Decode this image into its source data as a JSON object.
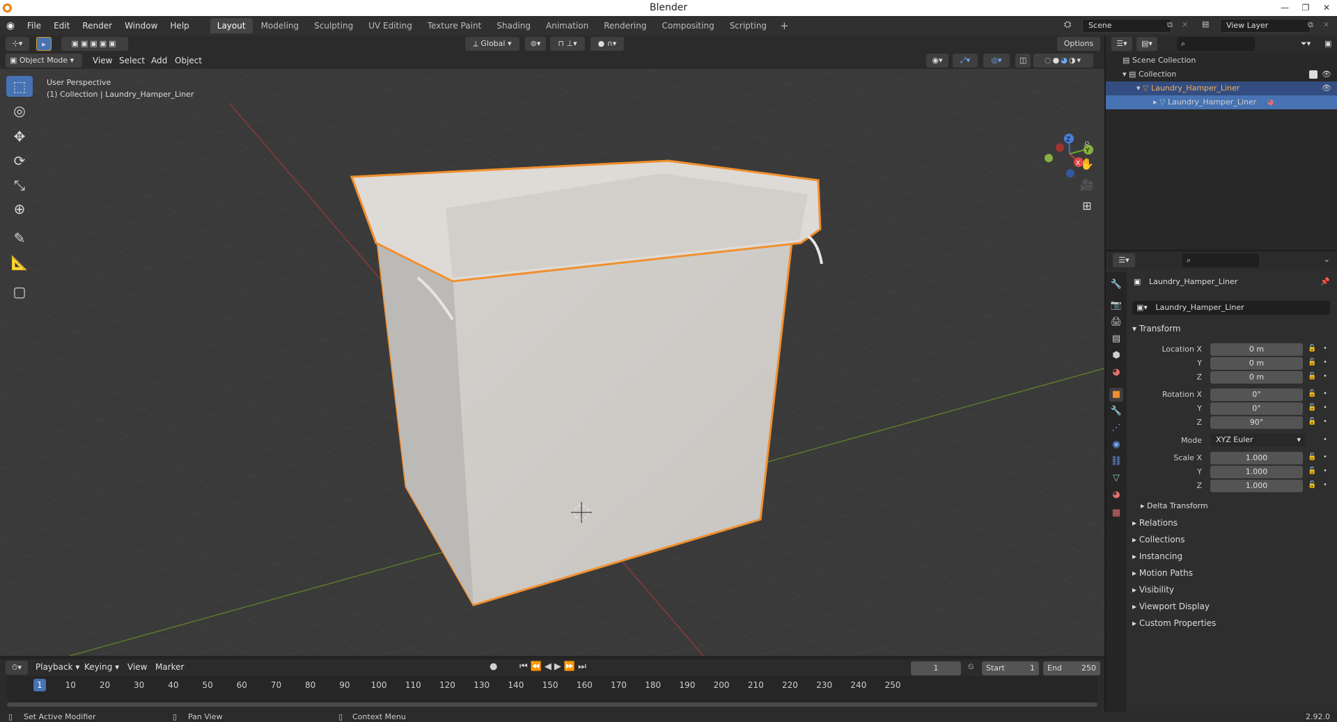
{
  "window": {
    "title": "Blender"
  },
  "menu": [
    "File",
    "Edit",
    "Render",
    "Window",
    "Help"
  ],
  "workspaces": [
    "Layout",
    "Modeling",
    "Sculpting",
    "UV Editing",
    "Texture Paint",
    "Shading",
    "Animation",
    "Rendering",
    "Compositing",
    "Scripting"
  ],
  "scene": {
    "scene_name": "Scene",
    "view_layer": "View Layer"
  },
  "viewport_header": {
    "orientation": "Global",
    "options": "Options",
    "mode": "Object Mode",
    "menus": [
      "View",
      "Select",
      "Add",
      "Object"
    ]
  },
  "viewport": {
    "perspective_label": "User Perspective",
    "collection_label": "(1) Collection | Laundry_Hamper_Liner",
    "axes": {
      "x": "X",
      "y": "Y",
      "z": "Z"
    }
  },
  "outliner": {
    "scene_collection": "Scene Collection",
    "collection": "Collection",
    "object": "Laundry_Hamper_Liner",
    "mesh": "Laundry_Hamper_Liner"
  },
  "properties": {
    "object_name": "Laundry_Hamper_Liner",
    "datablock_name": "Laundry_Hamper_Liner",
    "transform_title": "Transform",
    "labels": {
      "location_x": "Location X",
      "y": "Y",
      "z": "Z",
      "rotation_x": "Rotation X",
      "mode": "Mode",
      "scale_x": "Scale X"
    },
    "location": [
      "0 m",
      "0 m",
      "0 m"
    ],
    "rotation": [
      "0°",
      "0°",
      "90°"
    ],
    "rotation_mode": "XYZ Euler",
    "scale": [
      "1.000",
      "1.000",
      "1.000"
    ],
    "delta_transform": "Delta Transform",
    "panels": [
      "Relations",
      "Collections",
      "Instancing",
      "Motion Paths",
      "Visibility",
      "Viewport Display",
      "Custom Properties"
    ]
  },
  "timeline": {
    "menus": [
      "Playback",
      "Keying",
      "View",
      "Marker"
    ],
    "current_frame": "1",
    "start_label": "Start",
    "start": "1",
    "end_label": "End",
    "end": "250",
    "ticks": [
      "1",
      "10",
      "20",
      "30",
      "40",
      "50",
      "60",
      "70",
      "80",
      "90",
      "100",
      "110",
      "120",
      "130",
      "140",
      "150",
      "160",
      "170",
      "180",
      "190",
      "200",
      "210",
      "220",
      "230",
      "240",
      "250"
    ]
  },
  "statusbar": {
    "left": "Set Active Modifier",
    "middle": "Pan View",
    "right": "Context Menu",
    "version": "2.92.0"
  },
  "colors": {
    "accent": "#4772b3",
    "selection_outline": "#f1902e",
    "header": "#2b2b2b"
  }
}
